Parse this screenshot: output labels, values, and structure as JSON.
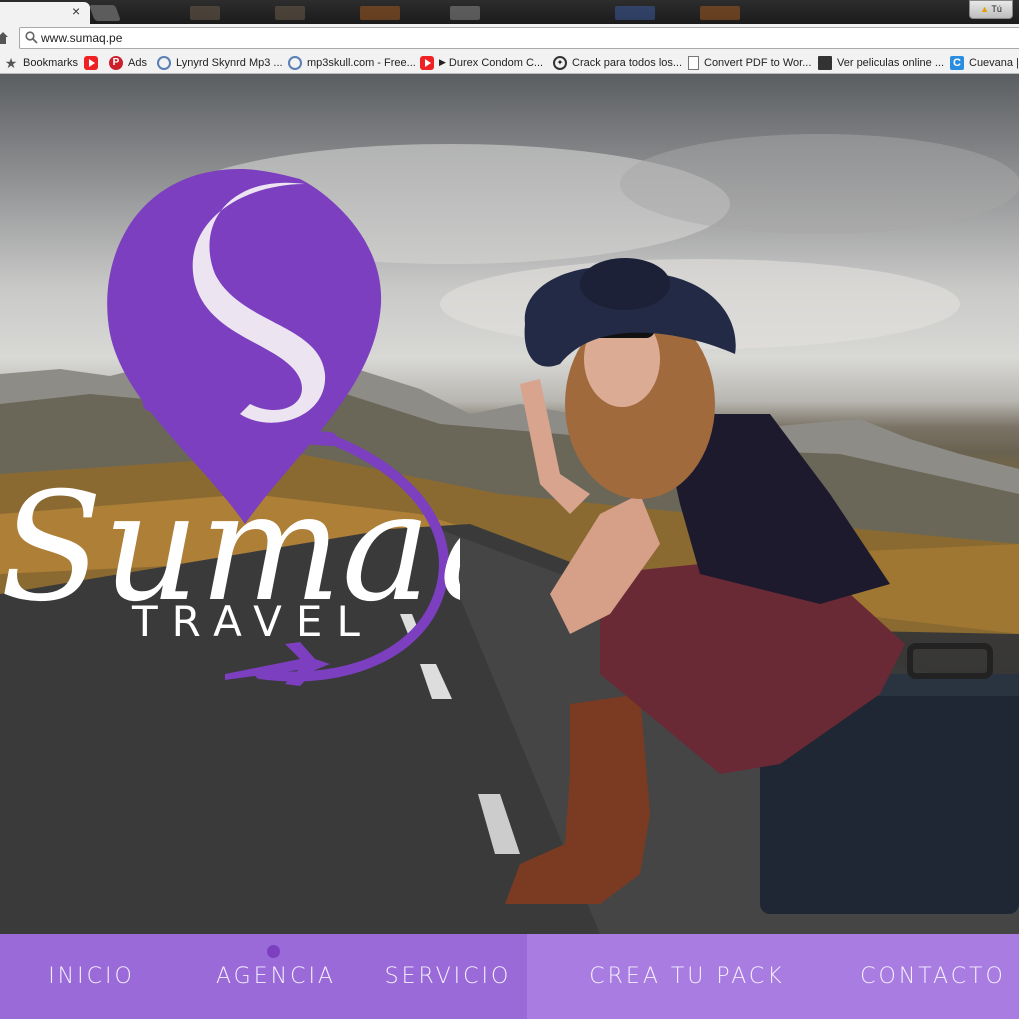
{
  "browser": {
    "tab_close_glyph": "×",
    "profile_label": "Tú",
    "address_bar": {
      "url": "www.sumaq.pe"
    },
    "bookmarks": [
      {
        "label": "Bookmarks",
        "icon": "star-icon"
      },
      {
        "label": "",
        "icon": "youtube-icon"
      },
      {
        "label": "Ads",
        "icon": "pinterest-icon"
      },
      {
        "label": "Lynyrd Skynrd Mp3 ...",
        "icon": "globe-icon"
      },
      {
        "label": "mp3skull.com - Free...",
        "icon": "globe-icon"
      },
      {
        "label": "Durex Condom C...",
        "icon": "youtube-icon",
        "prefix": "▶"
      },
      {
        "label": "Crack para todos los...",
        "icon": "crack-icon"
      },
      {
        "label": "Convert PDF to Wor...",
        "icon": "document-icon"
      },
      {
        "label": "Ver peliculas online ...",
        "icon": "film-icon"
      },
      {
        "label": "Cuevana |",
        "icon": "cuevana-icon"
      }
    ]
  },
  "hero": {
    "logo": {
      "script_text": "Sumaq",
      "subtitle": "TRAVEL",
      "brand_color": "#7b3fbf"
    }
  },
  "nav": {
    "items": [
      {
        "label": "INICIO"
      },
      {
        "label": "AGENCIA",
        "active": true
      },
      {
        "label": "SERVICIO"
      },
      {
        "label": "CREA TU PACK"
      },
      {
        "label": "CONTACTO"
      }
    ],
    "background_color": "#9a6ad8",
    "indicator_color": "#7b3fbf"
  }
}
